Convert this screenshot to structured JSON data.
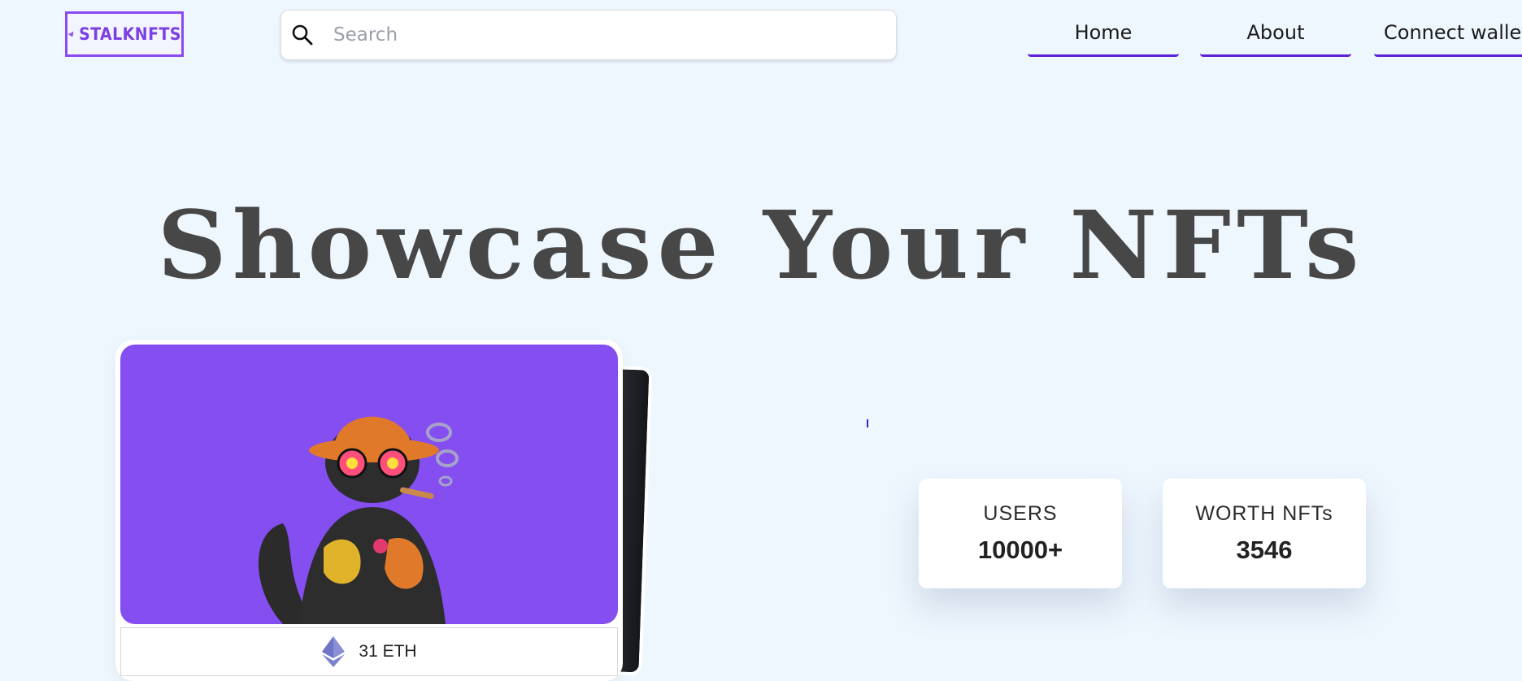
{
  "brand": {
    "name": "STALKNFTS",
    "color": "#8a4bf0"
  },
  "search": {
    "placeholder": "Search",
    "value": ""
  },
  "nav": {
    "items": [
      {
        "label": "Home"
      },
      {
        "label": "About"
      },
      {
        "label": "Connect wallet"
      }
    ],
    "accent": "#5a1fd6"
  },
  "hero": {
    "title": "Showcase Your NFTs"
  },
  "card": {
    "image_icon": "cat-nft-image",
    "image_background": "#844ef0",
    "price": "31 ETH",
    "currency_icon": "ethereum-icon"
  },
  "stats": [
    {
      "label": "USERS",
      "value": "10000+"
    },
    {
      "label": "WORTH NFTs",
      "value": "3546"
    }
  ]
}
